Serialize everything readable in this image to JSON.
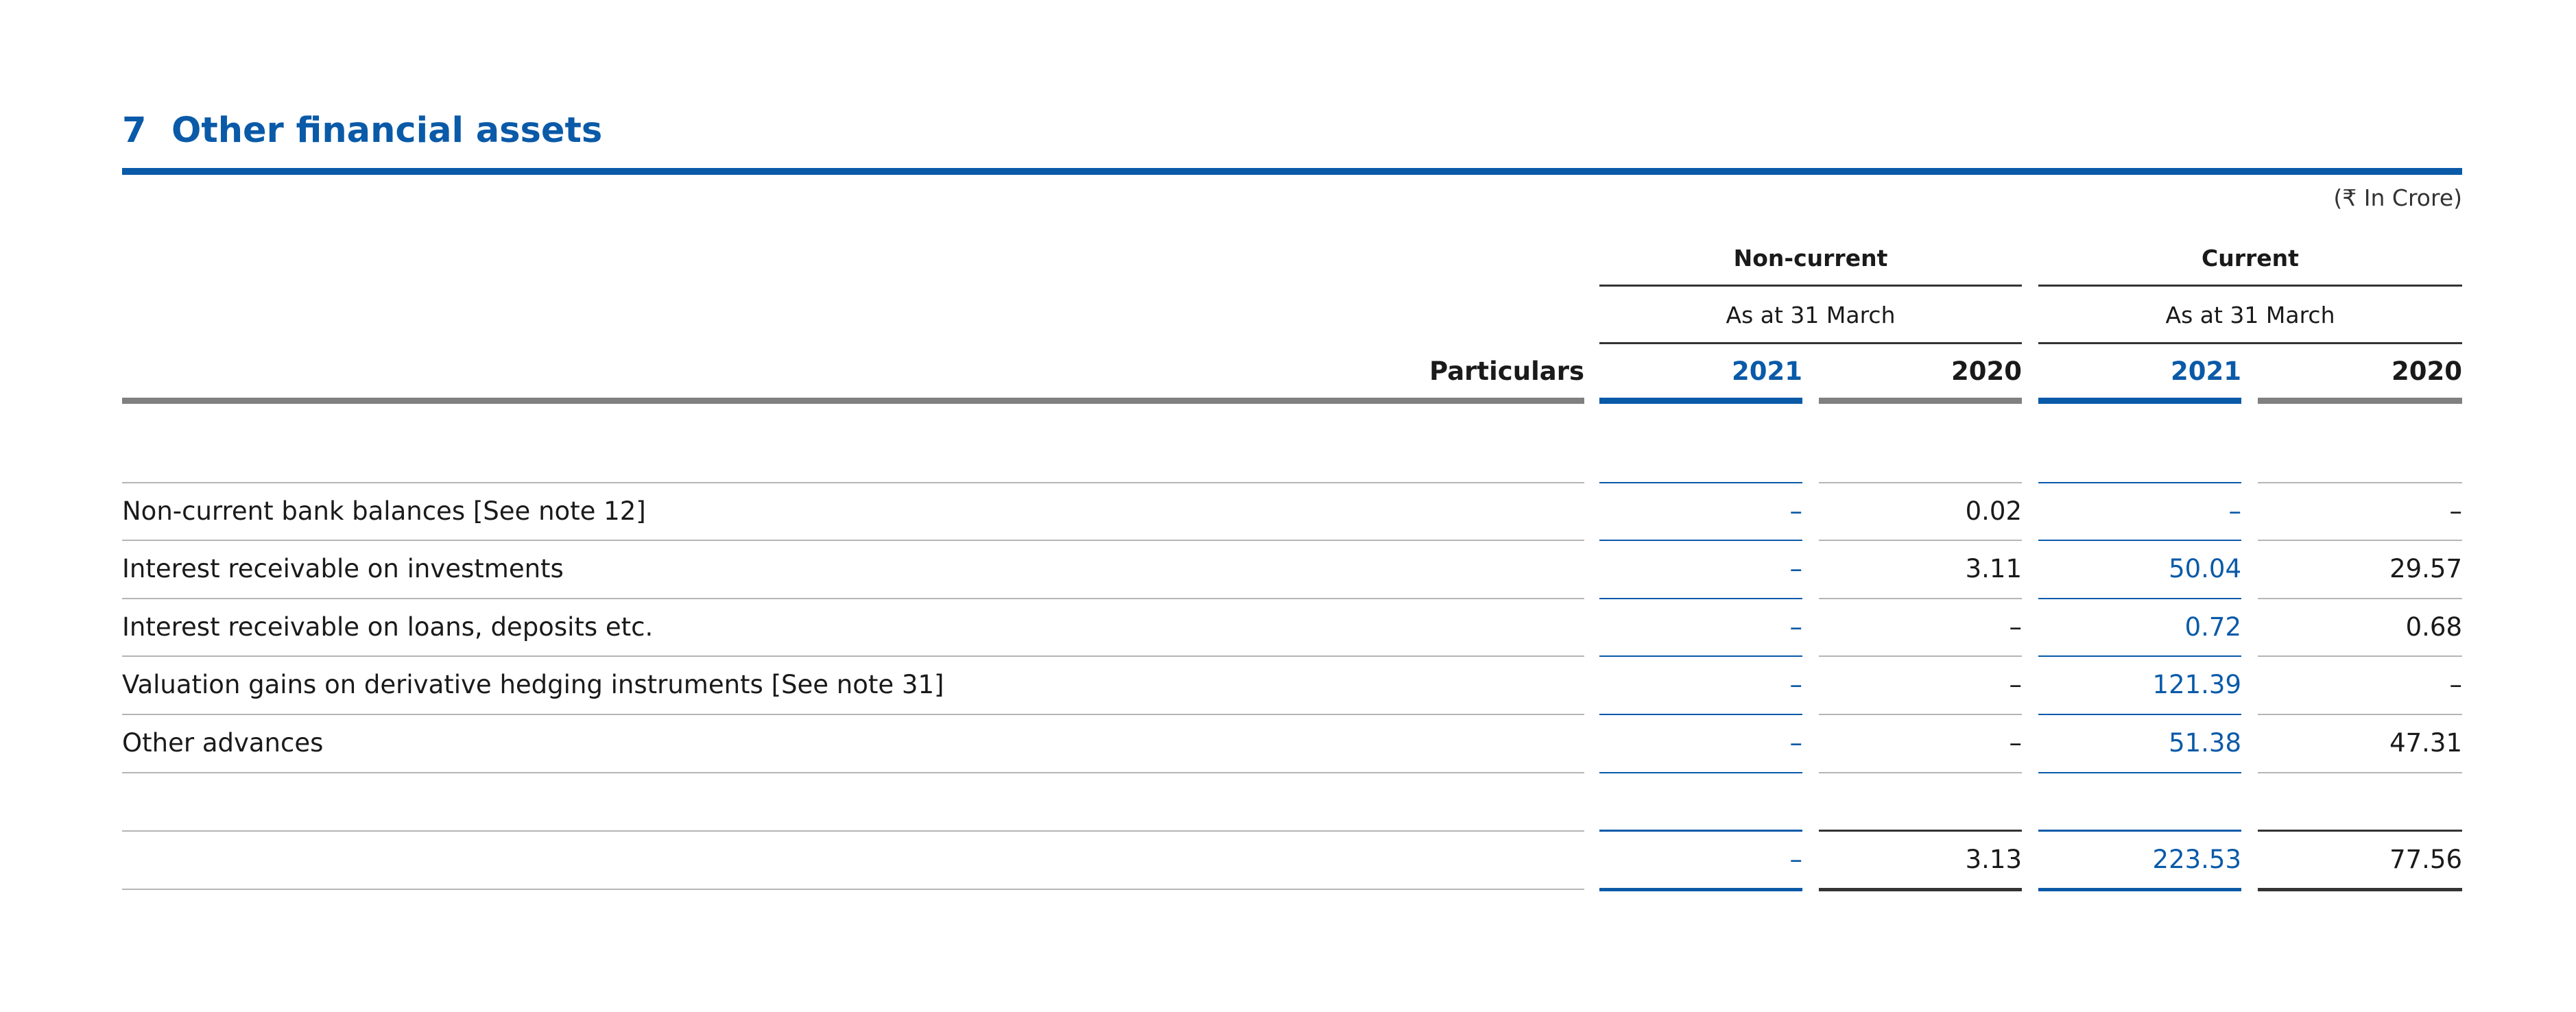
{
  "section": {
    "number": "7",
    "title": "Other financial assets"
  },
  "unit_note": "(₹ In Crore)",
  "table": {
    "groups": [
      {
        "label": "Non-current",
        "sublabel": "As at 31 March"
      },
      {
        "label": "Current",
        "sublabel": "As at 31 March"
      }
    ],
    "particulars_header": "Particulars",
    "years": [
      "2021",
      "2020",
      "2021",
      "2020"
    ],
    "rows": [
      {
        "label": "Non-current bank balances [See note 12]",
        "values": [
          "–",
          "0.02",
          "–",
          "–"
        ]
      },
      {
        "label": "Interest receivable on investments",
        "values": [
          "–",
          "3.11",
          "50.04",
          "29.57"
        ]
      },
      {
        "label": "Interest receivable on loans, deposits etc.",
        "values": [
          "–",
          "–",
          "0.72",
          "0.68"
        ]
      },
      {
        "label": "Valuation gains on derivative hedging instruments [See note 31]",
        "values": [
          "–",
          "–",
          "121.39",
          "–"
        ]
      },
      {
        "label": "Other advances",
        "values": [
          "–",
          "–",
          "51.38",
          "47.31"
        ]
      }
    ],
    "total": {
      "values": [
        "–",
        "3.13",
        "223.53",
        "77.56"
      ]
    }
  },
  "colors": {
    "accent": "#0a5aa8",
    "text": "#1a1a1a",
    "rule": "#b5b5b5"
  }
}
